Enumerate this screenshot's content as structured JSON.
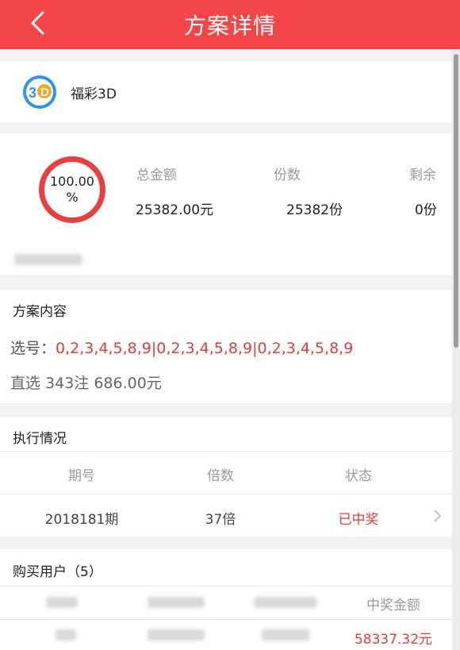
{
  "header": {
    "title": "方案详情",
    "back_icon": "chevron-left-icon"
  },
  "lottery": {
    "name": "福彩3D",
    "logo_text": "3D",
    "logo_color": "#2f93e8"
  },
  "progress": {
    "percent_text": "100.00",
    "percent_sign": "%",
    "percent_value": 100,
    "ring_color": "#e8403e",
    "stats": [
      {
        "label": "总金额",
        "value": "25382.00元"
      },
      {
        "label": "份数",
        "value": "25382份"
      },
      {
        "label": "剩余",
        "value": "0份"
      }
    ]
  },
  "plan": {
    "title": "方案内容",
    "numbers_label": "选号：",
    "numbers": "0,2,3,4,5,8,9|0,2,3,4,5,8,9|0,2,3,4,5,8,9",
    "bet_info": "直选 343注 686.00元"
  },
  "execution": {
    "title": "执行情况",
    "headers": [
      "期号",
      "倍数",
      "状态"
    ],
    "rows": [
      {
        "issue": "2018181期",
        "multiple": "37倍",
        "status": "已中奖"
      }
    ]
  },
  "buyers": {
    "title": "购买用户（5）",
    "prize_header": "中奖金额",
    "rows": [
      {
        "prize": "58337.32元"
      }
    ]
  },
  "colors": {
    "header": "#f24649",
    "accent_red": "#e43b3b"
  }
}
